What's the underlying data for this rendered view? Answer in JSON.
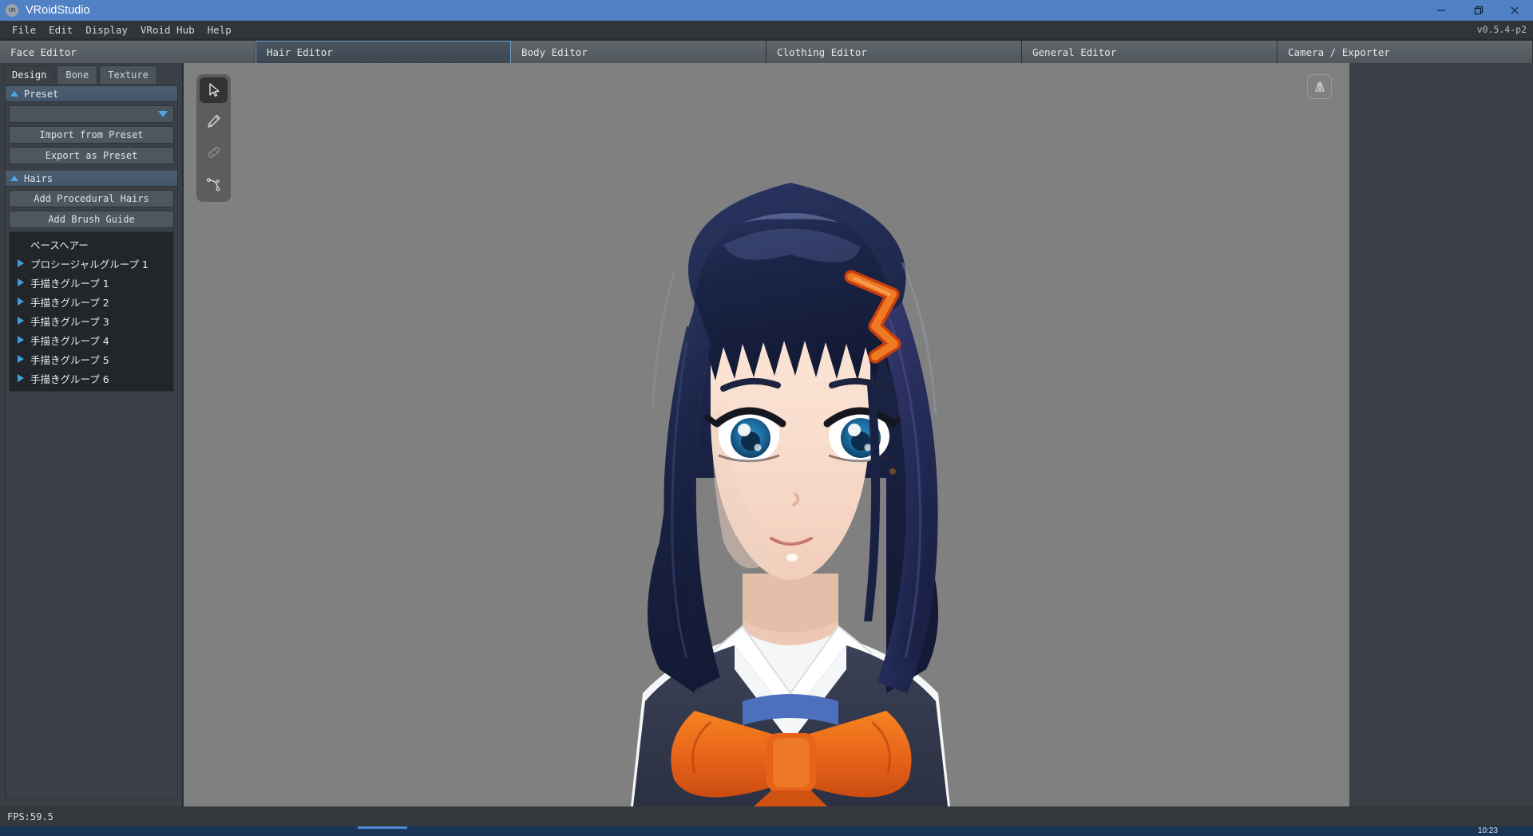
{
  "window": {
    "title": "VRoidStudio",
    "icon": "app-logo-icon",
    "version": "v0.5.4-p2",
    "minimize": "minimize-icon",
    "maximize": "maximize-icon",
    "close": "close-icon"
  },
  "menubar": {
    "items": [
      {
        "label": "File"
      },
      {
        "label": "Edit"
      },
      {
        "label": "Display"
      },
      {
        "label": "VRoid Hub"
      },
      {
        "label": "Help"
      }
    ]
  },
  "editor_tabs": [
    {
      "label": "Face Editor",
      "active": false
    },
    {
      "label": "Hair Editor",
      "active": true
    },
    {
      "label": "Body Editor",
      "active": false
    },
    {
      "label": "Clothing Editor",
      "active": false
    },
    {
      "label": "General Editor",
      "active": false
    },
    {
      "label": "Camera / Exporter",
      "active": false
    }
  ],
  "left_panel": {
    "subtabs": [
      {
        "label": "Design",
        "active": true
      },
      {
        "label": "Bone",
        "active": false
      },
      {
        "label": "Texture",
        "active": false
      }
    ],
    "preset_section": {
      "title": "Preset",
      "dropdown_value": "",
      "dropdown_placeholder": "",
      "buttons": [
        {
          "label": "Import from Preset"
        },
        {
          "label": "Export as Preset"
        }
      ]
    },
    "hairs_section": {
      "title": "Hairs",
      "buttons": [
        {
          "label": "Add Procedural Hairs"
        },
        {
          "label": "Add Brush Guide"
        }
      ],
      "items": [
        {
          "label": "ベースヘアー",
          "expandable": false
        },
        {
          "label": "プロシージャルグループ 1",
          "expandable": true
        },
        {
          "label": "手描きグループ 1",
          "expandable": true
        },
        {
          "label": "手描きグループ 2",
          "expandable": true
        },
        {
          "label": "手描きグループ 3",
          "expandable": true
        },
        {
          "label": "手描きグループ 4",
          "expandable": true
        },
        {
          "label": "手描きグループ 5",
          "expandable": true
        },
        {
          "label": "手描きグループ 6",
          "expandable": true
        }
      ]
    }
  },
  "viewport": {
    "background_color": "#808080",
    "tools": [
      {
        "name": "select-cursor-tool",
        "selected": true,
        "disabled": false
      },
      {
        "name": "pencil-tool",
        "selected": false,
        "disabled": false
      },
      {
        "name": "bandage-tool",
        "selected": false,
        "disabled": true
      },
      {
        "name": "curve-path-tool",
        "selected": false,
        "disabled": false
      }
    ],
    "mirror_button": "mirror-symmetry-icon"
  },
  "statusbar": {
    "fps": "FPS:59.5"
  },
  "taskbar": {
    "clock": "10:23"
  },
  "colors": {
    "titlebar": "#4f81c4",
    "accent": "#4ea8e6",
    "panel": "#3a4046",
    "viewport": "#808080",
    "hair": "#1d2647",
    "ribbon": "#e8631a",
    "hairclip": "#e8631a"
  }
}
